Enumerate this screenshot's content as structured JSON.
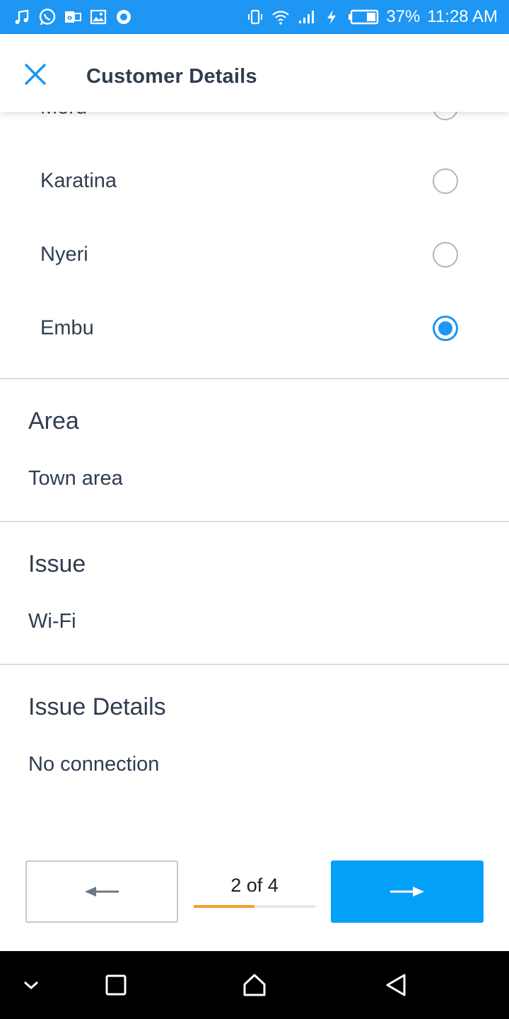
{
  "status_bar": {
    "battery_percent": "37%",
    "time": "11:28 AM",
    "left_icons": [
      "music-icon",
      "whatsapp-icon",
      "outlook-icon",
      "gallery-icon",
      "assistant-icon"
    ],
    "right_icons": [
      "vibrate-icon",
      "wifi-icon",
      "signal-icon",
      "charging-icon",
      "battery-icon"
    ]
  },
  "app_bar": {
    "title": "Customer Details",
    "close_icon": "close-icon"
  },
  "location_options": [
    {
      "label": "Meru",
      "selected": false
    },
    {
      "label": "Karatina",
      "selected": false
    },
    {
      "label": "Nyeri",
      "selected": false
    },
    {
      "label": "Embu",
      "selected": true
    }
  ],
  "fields": {
    "area": {
      "label": "Area",
      "value": "Town area"
    },
    "issue": {
      "label": "Issue",
      "value": "Wi-Fi"
    },
    "issue_details": {
      "label": "Issue Details",
      "value": "No connection"
    }
  },
  "pagination": {
    "indicator": "2 of 4",
    "progress": 0.5,
    "prev_icon": "arrow-left-icon",
    "next_icon": "arrow-right-icon"
  },
  "colors": {
    "accent": "#1e96f3",
    "primary_button": "#03a0f7",
    "progress": "#f4a026",
    "text": "#2f3d4f"
  },
  "system_nav": [
    "collapse-icon",
    "recents-icon",
    "home-icon",
    "back-icon"
  ]
}
